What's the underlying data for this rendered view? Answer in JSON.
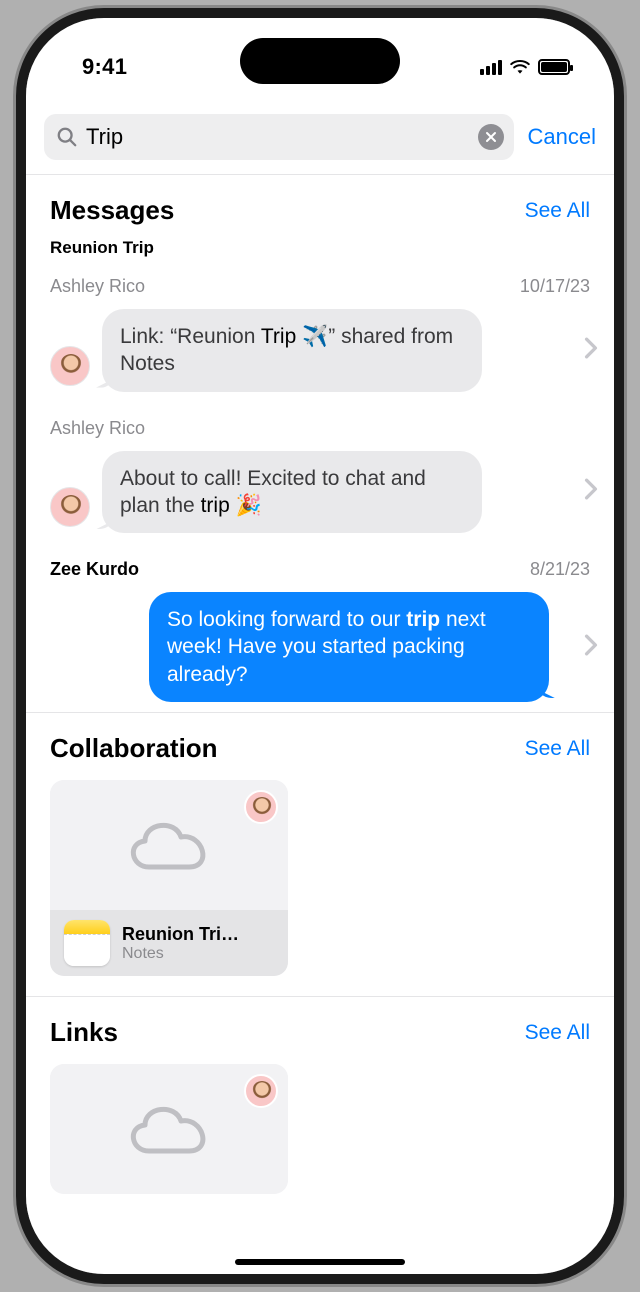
{
  "status": {
    "time": "9:41"
  },
  "search": {
    "query": "Trip",
    "cancel_label": "Cancel"
  },
  "sections": {
    "messages": {
      "title": "Messages",
      "see_all": "See All",
      "conversation_label": "Reunion Trip",
      "items": [
        {
          "sender": "Ashley Rico",
          "date": "10/17/23",
          "text_prefix": "Link: “Reunion ",
          "text_highlight": "Trip",
          "text_suffix": " ✈️” shared from Notes",
          "outgoing": false
        },
        {
          "sender": "Ashley Rico",
          "date": "",
          "text_prefix": "About to call! Excited to chat and plan the ",
          "text_highlight": "trip",
          "text_suffix": " 🎉",
          "outgoing": false
        },
        {
          "sender": "Zee Kurdo",
          "date": "8/21/23",
          "text_prefix": "So looking forward to our ",
          "text_highlight": "trip",
          "text_suffix": " next week! Have you started packing already?",
          "outgoing": true
        }
      ]
    },
    "collaboration": {
      "title": "Collaboration",
      "see_all": "See All",
      "card": {
        "title": "Reunion Tri…",
        "subtitle": "Notes"
      }
    },
    "links": {
      "title": "Links",
      "see_all": "See All"
    }
  }
}
